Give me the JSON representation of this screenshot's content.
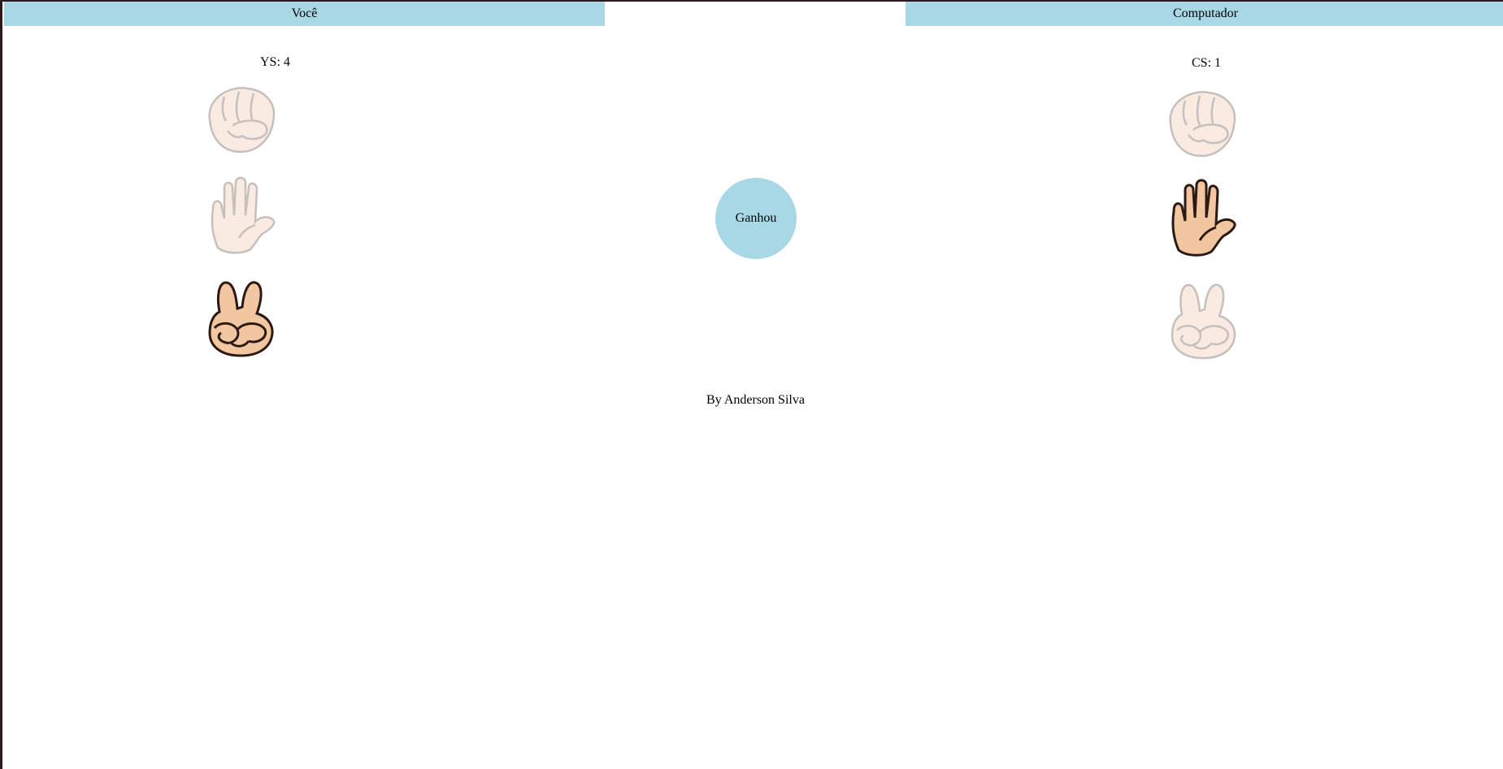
{
  "header": {
    "player_label": "Você",
    "computer_label": "Computador"
  },
  "scores": {
    "player_score": "YS: 4",
    "computer_score": "CS: 1"
  },
  "player_hands": [
    {
      "icon": "rock-hand-icon",
      "state": "inactive"
    },
    {
      "icon": "paper-hand-icon",
      "state": "inactive"
    },
    {
      "icon": "scissors-hand-icon",
      "state": "selected"
    }
  ],
  "computer_hands": [
    {
      "icon": "rock-hand-icon",
      "state": "inactive"
    },
    {
      "icon": "paper-hand-icon",
      "state": "selected"
    },
    {
      "icon": "scissors-hand-icon",
      "state": "inactive"
    }
  ],
  "result": {
    "label": "Ganhou"
  },
  "footer": {
    "credit": "By Anderson Silva"
  },
  "colors": {
    "header_bg": "#a8d8e6",
    "result_bg": "#a8d8e6",
    "skin_active": "#f2c6a0",
    "skin_inactive": "#f6dccb",
    "outline_active": "#2b1a14",
    "outline_inactive": "#9a8c86"
  }
}
